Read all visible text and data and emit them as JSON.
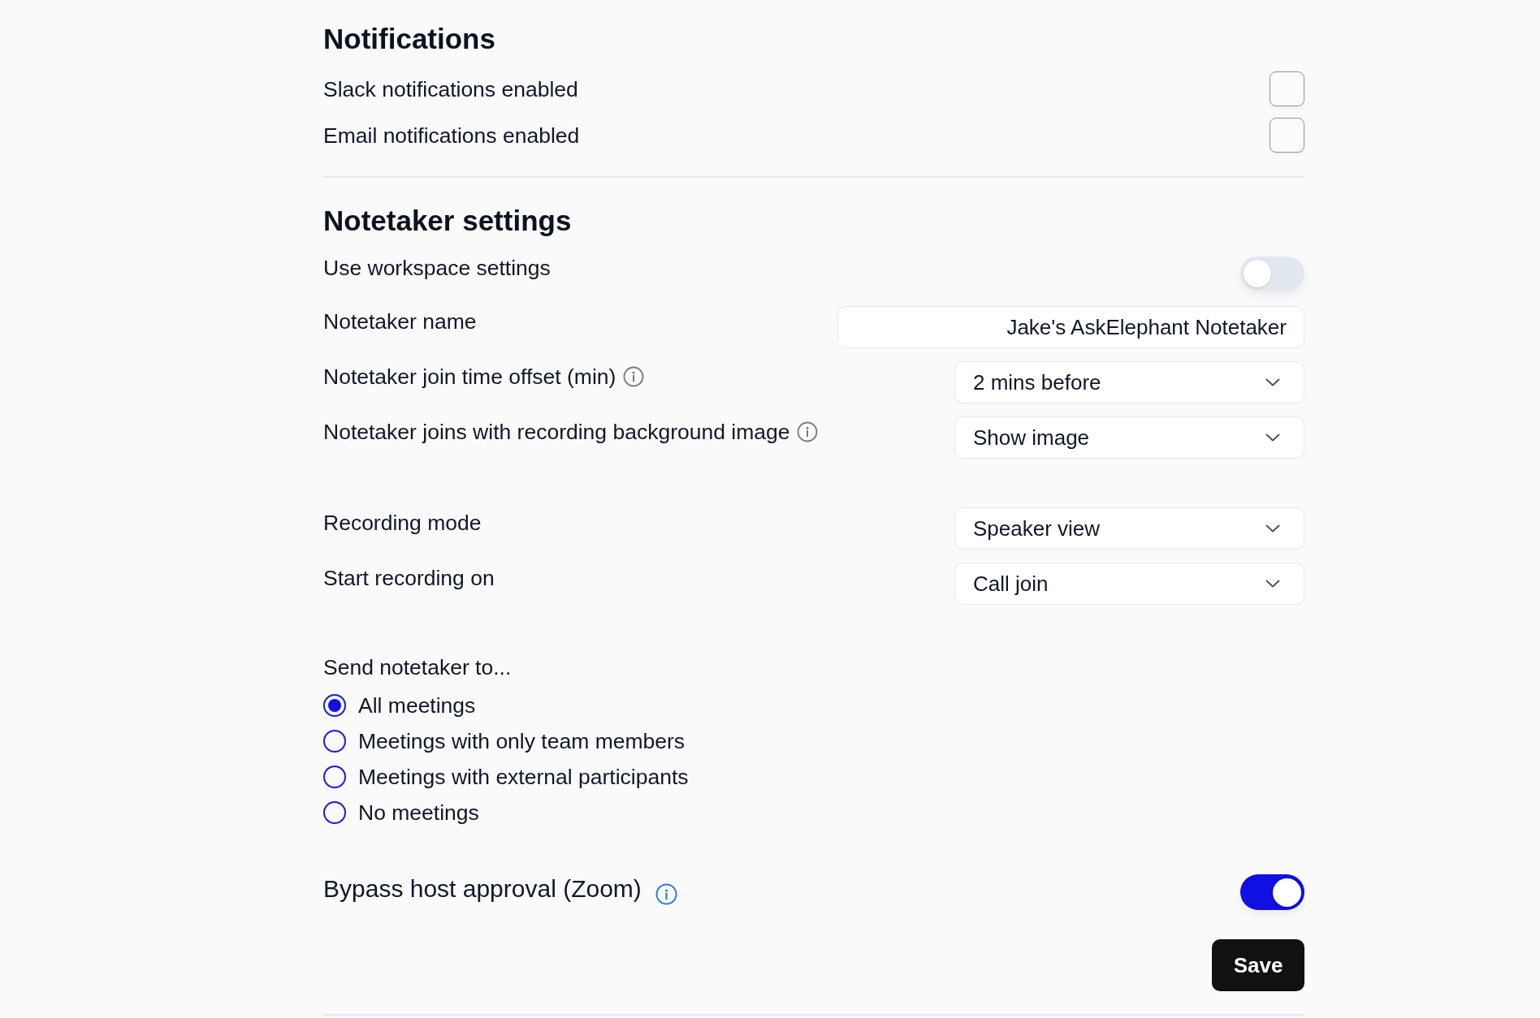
{
  "notifications": {
    "title": "Notifications",
    "items": [
      {
        "label": "Slack notifications enabled",
        "checked": false
      },
      {
        "label": "Email notifications enabled",
        "checked": false
      }
    ]
  },
  "notetaker_settings": {
    "title": "Notetaker settings",
    "use_workspace_settings": {
      "label": "Use workspace settings",
      "on": false
    },
    "field_groups": [
      {
        "fields": [
          {
            "kind": "text",
            "label": "Notetaker name",
            "info": false,
            "value": "Jake's AskElephant Notetaker"
          },
          {
            "kind": "select",
            "label": "Notetaker join time offset (min)",
            "info": true,
            "value": "2 mins before"
          },
          {
            "kind": "select",
            "label": "Notetaker joins with recording background image",
            "info": true,
            "value": "Show image"
          }
        ]
      },
      {
        "fields": [
          {
            "kind": "select",
            "label": "Recording mode",
            "info": false,
            "value": "Speaker view"
          },
          {
            "kind": "select",
            "label": "Start recording on",
            "info": false,
            "value": "Call join"
          }
        ]
      }
    ],
    "send_notetaker_to": {
      "label": "Send notetaker to...",
      "options": [
        {
          "label": "All meetings",
          "selected": true
        },
        {
          "label": "Meetings with only team members",
          "selected": false
        },
        {
          "label": "Meetings with external participants",
          "selected": false
        },
        {
          "label": "No meetings",
          "selected": false
        }
      ]
    },
    "bypass_host_approval": {
      "label": "Bypass host approval (Zoom)",
      "on": true
    }
  },
  "save_button": {
    "label": "Save"
  }
}
